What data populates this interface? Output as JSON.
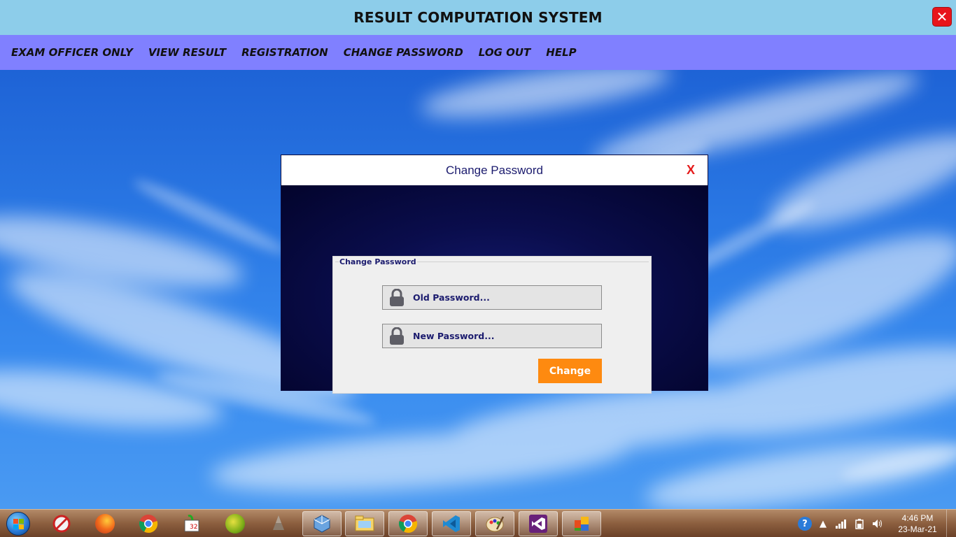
{
  "app": {
    "title": "RESULT COMPUTATION SYSTEM",
    "close_label": "✕"
  },
  "menu": {
    "items": [
      {
        "label": "EXAM OFFICER ONLY"
      },
      {
        "label": "VIEW RESULT"
      },
      {
        "label": "REGISTRATION"
      },
      {
        "label": "CHANGE PASSWORD"
      },
      {
        "label": "LOG OUT"
      },
      {
        "label": "HELP"
      }
    ]
  },
  "dialog": {
    "title": "Change Password",
    "close_label": "X",
    "group_title": "Change Password",
    "old_password_placeholder": "Old Password...",
    "new_password_placeholder": "New Password...",
    "change_label": "Change"
  },
  "taskbar": {
    "icons": [
      {
        "name": "snipping-tool-icon"
      },
      {
        "name": "firefox-icon"
      },
      {
        "name": "chrome-icon"
      },
      {
        "name": "ccleaner-icon"
      },
      {
        "name": "sublime-icon"
      },
      {
        "name": "inkscape-icon"
      },
      {
        "name": "virtualbox-icon"
      },
      {
        "name": "file-explorer-icon"
      },
      {
        "name": "chrome-profile-icon"
      },
      {
        "name": "vscode-icon"
      },
      {
        "name": "paint-icon"
      },
      {
        "name": "visual-studio-icon"
      },
      {
        "name": "office-icon"
      }
    ],
    "clock": {
      "time": "4:46 PM",
      "date": "23-Mar-21"
    }
  },
  "colors": {
    "titlebar": "#8dcdea",
    "menubar": "#8080ff",
    "dialog_body": "#05063a",
    "change_button": "#fe8a10",
    "accent_text": "#1b1b6e"
  }
}
